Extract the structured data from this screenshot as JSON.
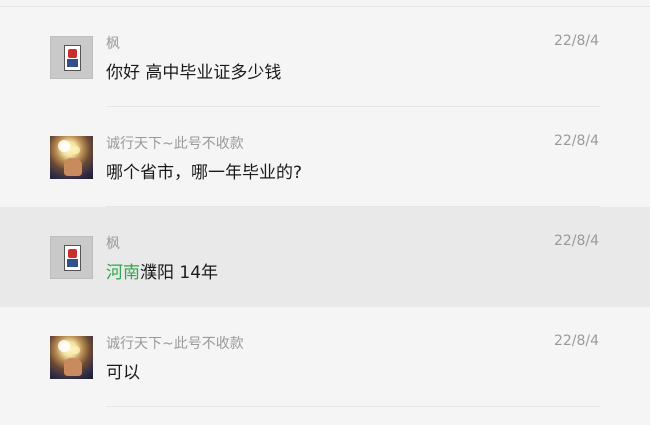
{
  "messages": [
    {
      "sender": "枫",
      "time": "22/8/4",
      "text": "你好 高中毕业证多少钱",
      "avatar_icon": "stamp-avatar-icon"
    },
    {
      "sender": "诚行天下~此号不收款",
      "time": "22/8/4",
      "text": "哪个省市，哪一年毕业的?",
      "avatar_icon": "photo-avatar-icon"
    },
    {
      "sender": "枫",
      "time": "22/8/4",
      "text_highlight": "河南",
      "text_rest": "濮阳 14年",
      "highlight_color": "#2ea84a",
      "avatar_icon": "stamp-avatar-icon",
      "active": true
    },
    {
      "sender": "诚行天下~此号不收款",
      "time": "22/8/4",
      "text": "可以",
      "avatar_icon": "photo-avatar-icon"
    }
  ]
}
